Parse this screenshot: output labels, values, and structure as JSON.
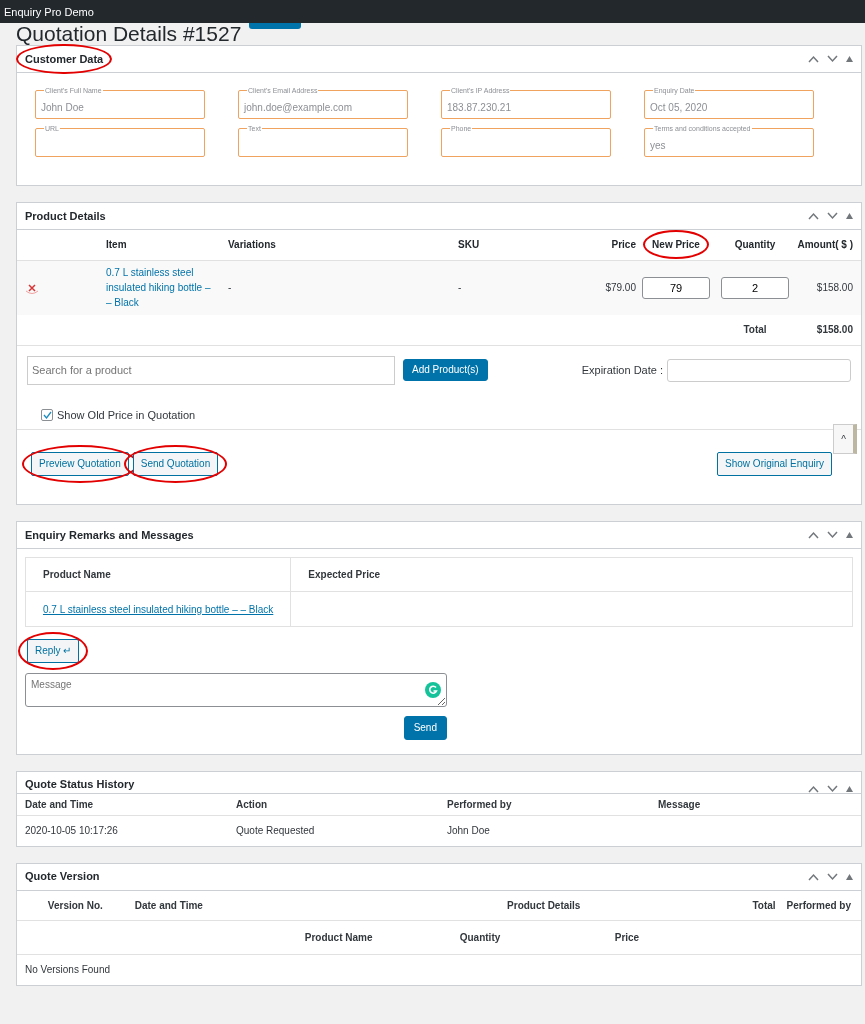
{
  "app_title": "Enquiry Pro Demo",
  "page": {
    "title": "Quotation Details #1527"
  },
  "customer_data": {
    "title": "Customer Data",
    "circled": true,
    "fields": [
      {
        "label": "Client's Full Name",
        "value": "John Doe"
      },
      {
        "label": "Client's Email Address",
        "value": "john.doe@example.com"
      },
      {
        "label": "Client's IP Address",
        "value": "183.87.230.21"
      },
      {
        "label": "Enquiry Date",
        "value": "Oct 05, 2020"
      },
      {
        "label": "URL"
      },
      {
        "label": "Text"
      },
      {
        "label": "Phone"
      },
      {
        "label": "Terms and conditions accepted",
        "value": "yes"
      }
    ]
  },
  "product_details": {
    "title": "Product Details",
    "columns": [
      {
        "label": "Item",
        "circled": false
      },
      {
        "label": "Variations",
        "circled": false
      },
      {
        "label": "SKU",
        "circled": false
      },
      {
        "label": "Price",
        "circled": false
      },
      {
        "label": "New Price",
        "circled": true
      },
      {
        "label": "Quantity",
        "circled": false
      },
      {
        "label": "Amount( $ )",
        "circled": false
      }
    ],
    "rows": [
      {
        "item": "0.7 L stainless steel insulated hiking bottle – – Black",
        "variations": "-",
        "sku": "-",
        "price": "$79.00",
        "new_price": "79",
        "quantity": "2",
        "amount": "$158.00"
      }
    ],
    "total_label": "Total",
    "total": "$158.00",
    "search": {
      "placeholder": "Search for a product"
    },
    "add_button": "Add Product(s)",
    "expiration_label": "Expiration Date :",
    "show_old_price": {
      "label": "Show Old Price in Quotation",
      "checked": true
    },
    "buttons": [
      {
        "label": "Preview Quotation",
        "circled": true
      },
      {
        "label": "Send Quotation",
        "circled": true
      },
      {
        "label": "Show Original Enquiry",
        "circled": false
      }
    ],
    "scroll_top": "^"
  },
  "remarks": {
    "title": "Enquiry Remarks and Messages",
    "columns": [
      "Product Name",
      "Expected Price"
    ],
    "rows": [
      {
        "product_name": "0.7 L stainless steel insulated hiking bottle – – Black"
      }
    ],
    "reply_button": {
      "label": "Reply ↵",
      "circled": true
    },
    "message": {
      "placeholder": "Message"
    },
    "send_button": "Send"
  },
  "status_history": {
    "title": "Quote Status History",
    "columns": [
      "Date and Time",
      "Action",
      "Performed by",
      "Message"
    ],
    "rows": [
      [
        "2020-10-05 10:17:26",
        "Quote Requested",
        "John Doe"
      ]
    ]
  },
  "quote_version": {
    "title": "Quote Version",
    "columns": [
      "Version No.",
      "Date and Time",
      "Product Details",
      "Total",
      "Performed by"
    ],
    "sub_columns": [
      "Product Name",
      "Quantity",
      "Price"
    ],
    "empty_text": "No Versions Found"
  }
}
